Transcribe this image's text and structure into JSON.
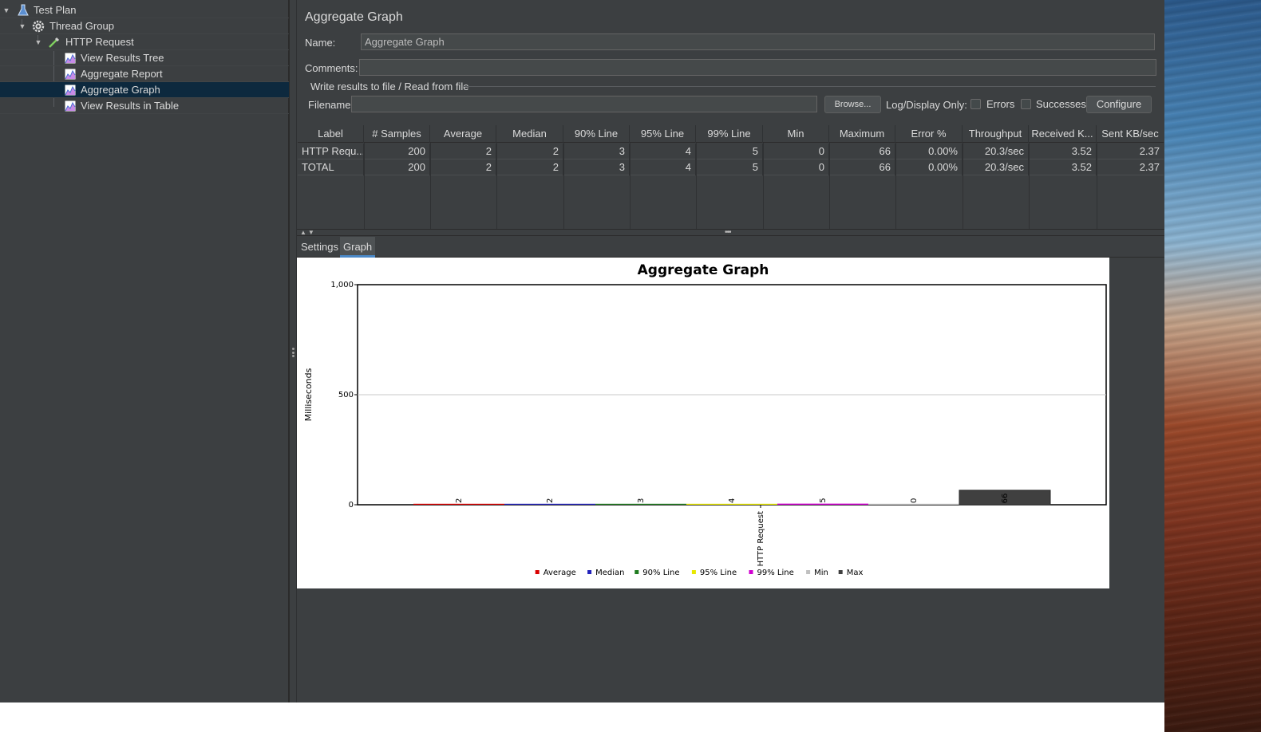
{
  "tree": {
    "items": [
      {
        "label": "Test Plan",
        "icon": "flask-icon"
      },
      {
        "label": "Thread Group",
        "icon": "gear-icon"
      },
      {
        "label": "HTTP Request",
        "icon": "pipette-icon"
      },
      {
        "label": "View Results Tree",
        "icon": "graph-icon"
      },
      {
        "label": "Aggregate Report",
        "icon": "graph-icon"
      },
      {
        "label": "Aggregate Graph",
        "icon": "graph-icon"
      },
      {
        "label": "View Results in Table",
        "icon": "graph-icon"
      }
    ],
    "selected": "Aggregate Graph"
  },
  "panel": {
    "title": "Aggregate Graph",
    "name_label": "Name:",
    "name_value": "Aggregate Graph",
    "comments_label": "Comments:",
    "comments_value": "",
    "file_group_title": "Write results to file / Read from file",
    "filename_label": "Filename",
    "filename_value": "",
    "browse_label": "Browse...",
    "log_display_label": "Log/Display Only:",
    "errors_label": "Errors",
    "successes_label": "Successes",
    "configure_label": "Configure"
  },
  "table": {
    "columns": [
      "Label",
      "# Samples",
      "Average",
      "Median",
      "90% Line",
      "95% Line",
      "99% Line",
      "Min",
      "Maximum",
      "Error %",
      "Throughput",
      "Received K...",
      "Sent KB/sec"
    ],
    "rows": [
      [
        "HTTP Requ...",
        "200",
        "2",
        "2",
        "3",
        "4",
        "5",
        "0",
        "66",
        "0.00%",
        "20.3/sec",
        "3.52",
        "2.37"
      ],
      [
        "TOTAL",
        "200",
        "2",
        "2",
        "3",
        "4",
        "5",
        "0",
        "66",
        "0.00%",
        "20.3/sec",
        "3.52",
        "2.37"
      ]
    ]
  },
  "tabs": [
    "Settings",
    "Graph"
  ],
  "active_tab": "Graph",
  "chart_data": {
    "type": "bar",
    "title": "Aggregate Graph",
    "ylabel": "Milliseconds",
    "xlabel": "",
    "categories": [
      "HTTP Request"
    ],
    "ylim": [
      0,
      1000
    ],
    "yticks": [
      "0",
      "500",
      "1,000"
    ],
    "grid": true,
    "legend_position": "bottom",
    "series": [
      {
        "name": "Average",
        "values": [
          2
        ],
        "color": "#d90000"
      },
      {
        "name": "Median",
        "values": [
          2
        ],
        "color": "#2222bb"
      },
      {
        "name": "90% Line",
        "values": [
          3
        ],
        "color": "#1e7b1e"
      },
      {
        "name": "95% Line",
        "values": [
          4
        ],
        "color": "#e8e800"
      },
      {
        "name": "99% Line",
        "values": [
          5
        ],
        "color": "#d000d0"
      },
      {
        "name": "Min",
        "values": [
          0
        ],
        "color": "#c0c0c0"
      },
      {
        "name": "Max",
        "values": [
          66
        ],
        "color": "#404040"
      }
    ]
  },
  "colors": {
    "window_bg": "#3c3f41",
    "selection_bg": "#0d293e",
    "tab_accent": "#4a88c7"
  }
}
